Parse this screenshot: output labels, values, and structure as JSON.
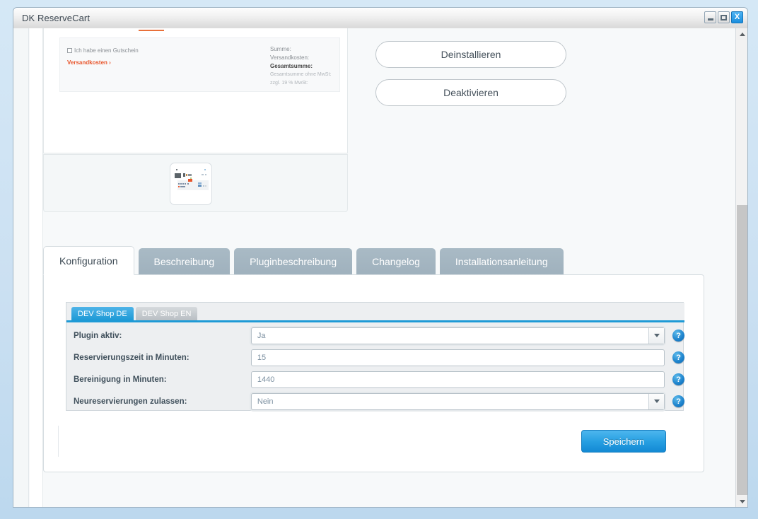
{
  "window": {
    "title": "DK ReserveCart",
    "minimize_label": "_",
    "maximize_label": "□",
    "close_label": "X"
  },
  "preview": {
    "cart": {
      "voucher_label": "Ich habe einen Gutschein",
      "shipping_link": "Versandkosten ›",
      "totals": [
        {
          "label": "Summe:",
          "style": "normal"
        },
        {
          "label": "Versandkosten:",
          "style": "normal"
        },
        {
          "label": "Gesamtsumme:",
          "style": "strong"
        },
        {
          "label": "Gesamtsumme ohne MwSt:",
          "style": "faint"
        },
        {
          "label": "zzgl. 19 % MwSt:",
          "style": "faint"
        }
      ]
    },
    "thumbnail_name": "plugin-screenshot-thumbnail"
  },
  "actions": {
    "uninstall_label": "Deinstallieren",
    "deactivate_label": "Deaktivieren"
  },
  "tabs": [
    {
      "label": "Konfiguration",
      "active": true
    },
    {
      "label": "Beschreibung",
      "active": false
    },
    {
      "label": "Pluginbeschreibung",
      "active": false
    },
    {
      "label": "Changelog",
      "active": false
    },
    {
      "label": "Installationsanleitung",
      "active": false
    }
  ],
  "shop_tabs": [
    {
      "label": "DEV Shop DE",
      "active": true
    },
    {
      "label": "DEV Shop EN",
      "active": false
    }
  ],
  "form": {
    "rows": [
      {
        "label": "Plugin aktiv:",
        "value": "Ja",
        "type": "select",
        "help": "?"
      },
      {
        "label": "Reservierungszeit in Minuten:",
        "value": "15",
        "type": "text",
        "help": "?"
      },
      {
        "label": "Bereinigung in Minuten:",
        "value": "1440",
        "type": "text",
        "help": "?"
      },
      {
        "label": "Neureservierungen zulassen:",
        "value": "Nein",
        "type": "select",
        "help": "?"
      }
    ],
    "save_label": "Speichern"
  },
  "colors": {
    "accent_blue": "#1e9ad6",
    "tab_gray": "#a9bac5",
    "orange": "#e8552b"
  }
}
